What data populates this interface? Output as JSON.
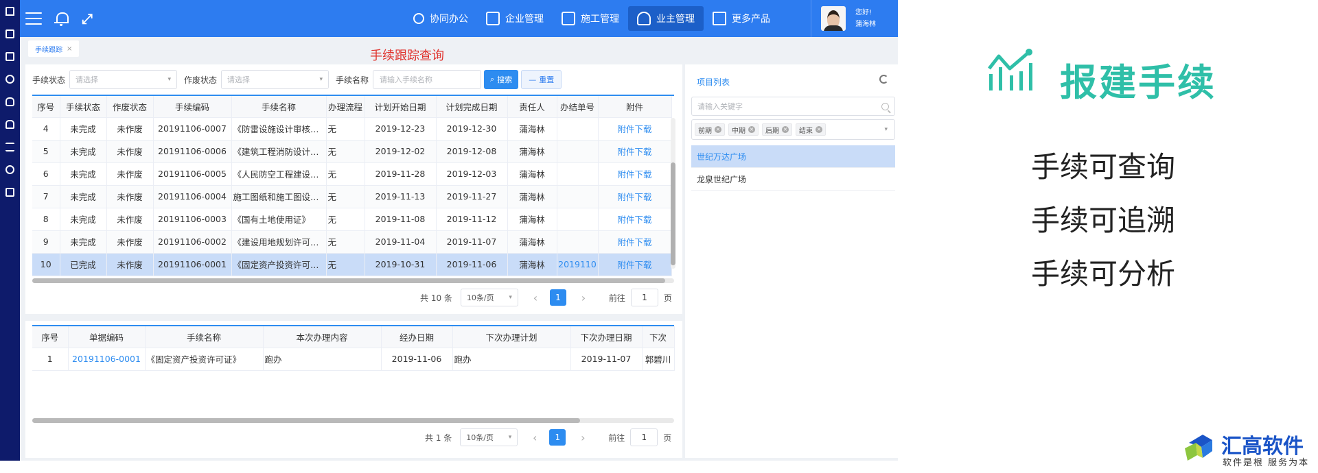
{
  "rail": {
    "items": [
      "home-icon",
      "edit-icon",
      "inbox-icon",
      "database-icon",
      "moneybag-icon",
      "car-icon",
      "hourglass-icon",
      "people-icon",
      "list-icon"
    ]
  },
  "topnav": {
    "items": [
      {
        "label": "协同办公",
        "icon": "flow-icon",
        "active": false
      },
      {
        "label": "企业管理",
        "icon": "building-icon",
        "active": false
      },
      {
        "label": "施工管理",
        "icon": "document-icon",
        "active": false
      },
      {
        "label": "业主管理",
        "icon": "person-icon",
        "active": true
      },
      {
        "label": "更多产品",
        "icon": "grid-icon",
        "active": false
      }
    ],
    "user": {
      "greeting": "您好!",
      "name": "蒲海林"
    }
  },
  "tabs": [
    {
      "label": "手续跟踪",
      "close": "×"
    }
  ],
  "overlay_title": "手续跟踪查询",
  "filters": {
    "status_label": "手续状态",
    "status_placeholder": "请选择",
    "void_label": "作废状态",
    "void_placeholder": "请选择",
    "name_label": "手续名称",
    "name_placeholder": "请输入手续名称",
    "search_button": "搜索",
    "reset_button": "重置"
  },
  "main_table": {
    "columns": [
      "序号",
      "手续状态",
      "作废状态",
      "手续编码",
      "手续名称",
      "办理流程",
      "计划开始日期",
      "计划完成日期",
      "责任人",
      "办结单号",
      "附件"
    ],
    "rows": [
      {
        "no": "4",
        "status": "未完成",
        "void": "未作废",
        "code": "20191106-0007",
        "name": "《防雷设施设计审核书》",
        "flow": "无",
        "start": "2019-12-23",
        "end": "2019-12-30",
        "owner": "蒲海林",
        "done_no": "",
        "attach": "附件下载"
      },
      {
        "no": "5",
        "status": "未完成",
        "void": "未作废",
        "code": "20191106-0006",
        "name": "《建筑工程消防设计审...",
        "flow": "无",
        "start": "2019-12-02",
        "end": "2019-12-08",
        "owner": "蒲海林",
        "done_no": "",
        "attach": "附件下载"
      },
      {
        "no": "6",
        "status": "未完成",
        "void": "未作废",
        "code": "20191106-0005",
        "name": "《人民防空工程建设许...",
        "flow": "无",
        "start": "2019-11-28",
        "end": "2019-12-03",
        "owner": "蒲海林",
        "done_no": "",
        "attach": "附件下载"
      },
      {
        "no": "7",
        "status": "未完成",
        "void": "未作废",
        "code": "20191106-0004",
        "name": "施工图纸和施工图设计...",
        "flow": "无",
        "start": "2019-11-13",
        "end": "2019-11-27",
        "owner": "蒲海林",
        "done_no": "",
        "attach": "附件下载"
      },
      {
        "no": "8",
        "status": "未完成",
        "void": "未作废",
        "code": "20191106-0003",
        "name": "《国有土地使用证》",
        "flow": "无",
        "start": "2019-11-08",
        "end": "2019-11-12",
        "owner": "蒲海林",
        "done_no": "",
        "attach": "附件下载"
      },
      {
        "no": "9",
        "status": "未完成",
        "void": "未作废",
        "code": "20191106-0002",
        "name": "《建设用地规划许可证...",
        "flow": "无",
        "start": "2019-11-04",
        "end": "2019-11-07",
        "owner": "蒲海林",
        "done_no": "",
        "attach": "附件下载"
      },
      {
        "no": "10",
        "status": "已完成",
        "void": "未作废",
        "code": "20191106-0001",
        "name": "《固定资产投资许可证》",
        "flow": "无",
        "start": "2019-10-31",
        "end": "2019-11-06",
        "owner": "蒲海林",
        "done_no": "2019110",
        "attach": "附件下载"
      }
    ]
  },
  "main_pager": {
    "total": "共 10 条",
    "size": "10条/页",
    "prev": "‹",
    "current": "1",
    "next": "›",
    "goto_label": "前往",
    "goto_value": "1",
    "page_suffix": "页"
  },
  "detail_table": {
    "columns": [
      "序号",
      "单据编码",
      "手续名称",
      "本次办理内容",
      "经办日期",
      "下次办理计划",
      "下次办理日期",
      "下次"
    ],
    "rows": [
      {
        "no": "1",
        "code": "20191106-0001",
        "name": "《固定资产投资许可证》",
        "content": "跑办",
        "date": "2019-11-06",
        "next_plan": "跑办",
        "next_date": "2019-11-07",
        "next_person": "郭碧川"
      }
    ]
  },
  "detail_pager": {
    "total": "共 1 条",
    "size": "10条/页",
    "prev": "‹",
    "current": "1",
    "next": "›",
    "goto_label": "前往",
    "goto_value": "1",
    "page_suffix": "页"
  },
  "project_list": {
    "title": "项目列表",
    "search_placeholder": "请输入关键字",
    "tags": [
      "前期",
      "中期",
      "后期",
      "结束"
    ],
    "items": [
      {
        "label": "世纪万达广场",
        "active": true
      },
      {
        "label": "龙泉世纪广场",
        "active": false
      }
    ]
  },
  "marketing": {
    "title": "报建手续",
    "features": [
      "手续可查询",
      "手续可追溯",
      "手续可分析"
    ],
    "brand_color": "#2fbfa8",
    "company": "汇高软件",
    "slogan": "软件是根  服务为本"
  },
  "colors": {
    "topbar": "#2d7cf0",
    "rail": "#0e1b6b",
    "selected_row": "#c9dcf8",
    "link": "#2d8cf0",
    "overlay_title": "#e0322c"
  }
}
